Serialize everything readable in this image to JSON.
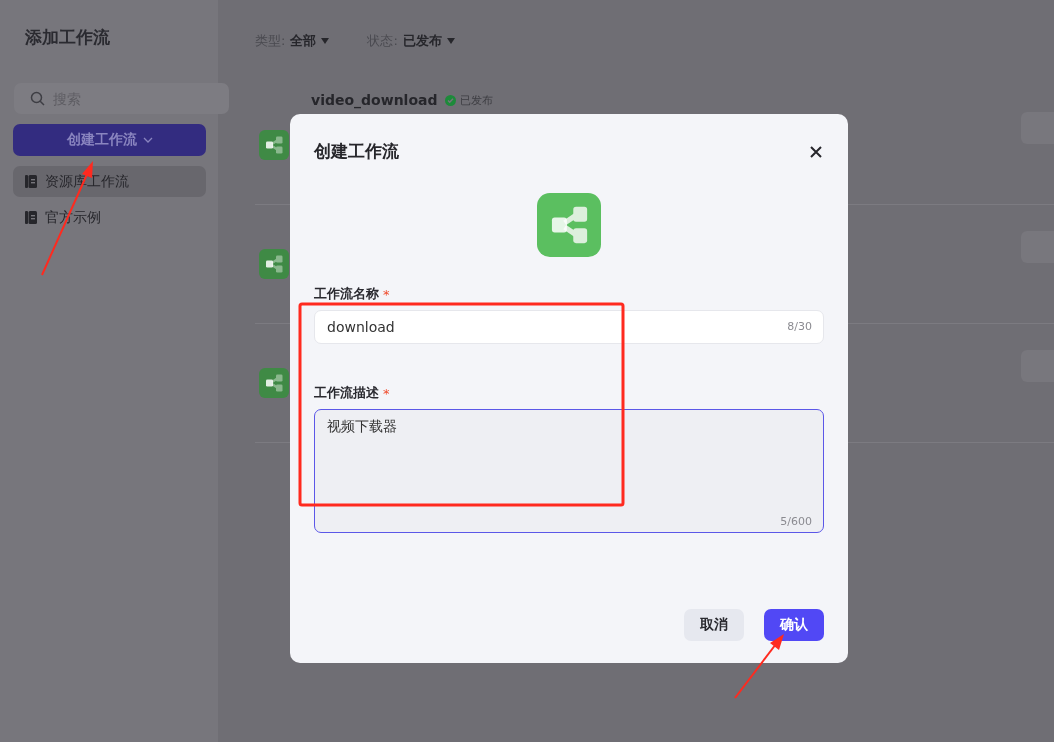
{
  "sidebar": {
    "title": "添加工作流",
    "search": {
      "placeholder": "搜索"
    },
    "create_button": "创建工作流",
    "items": [
      {
        "label": "资源库工作流",
        "selected": true
      },
      {
        "label": "官方示例",
        "selected": false
      }
    ]
  },
  "filters": [
    {
      "label": "类型:",
      "value": "全部"
    },
    {
      "label": "状态:",
      "value": "已发布"
    }
  ],
  "rows": [
    {
      "title": "video_download",
      "status": "已发布"
    },
    {},
    {}
  ],
  "dialog": {
    "title": "创建工作流",
    "fields": [
      {
        "kind": "input",
        "label": "工作流名称",
        "required_mark": "*",
        "value": "download",
        "counter": "8/30",
        "focused": false
      },
      {
        "kind": "textarea",
        "label": "工作流描述",
        "required_mark": "*",
        "value": "视频下载器",
        "counter": "5/600",
        "focused": true
      }
    ],
    "buttons": [
      {
        "label": "取消",
        "primary": false
      },
      {
        "label": "确认",
        "primary": true
      }
    ]
  }
}
